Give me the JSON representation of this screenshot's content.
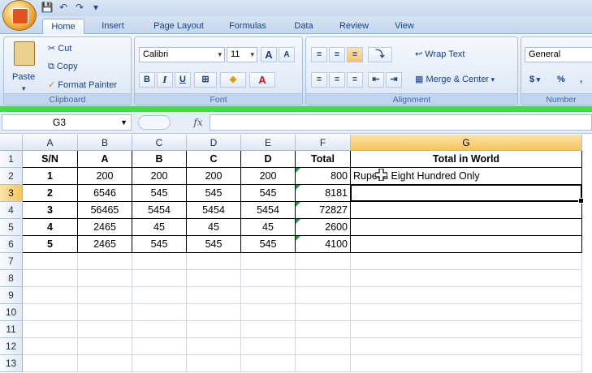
{
  "quick_access": {
    "save_icon": "save-icon",
    "undo_icon": "undo-icon",
    "redo_icon": "redo-icon"
  },
  "tabs": [
    "Home",
    "Insert",
    "Page Layout",
    "Formulas",
    "Data",
    "Review",
    "View"
  ],
  "clipboard": {
    "paste": "Paste",
    "cut": "Cut",
    "copy": "Copy",
    "format_painter": "Format Painter",
    "label": "Clipboard"
  },
  "font": {
    "name": "Calibri",
    "size": "11",
    "bold": "B",
    "italic": "I",
    "underline": "U",
    "label": "Font",
    "grow": "A",
    "shrink": "A"
  },
  "alignment": {
    "wrap_text": "Wrap Text",
    "merge_center": "Merge & Center",
    "label": "Alignment"
  },
  "number": {
    "format": "General",
    "currency": "$",
    "percent": "%",
    "comma": ",",
    "label": "Number"
  },
  "formula_bar": {
    "name_box": "G3",
    "fx": "fx",
    "value": ""
  },
  "columns": [
    "A",
    "B",
    "C",
    "D",
    "E",
    "F",
    "G"
  ],
  "rows": [
    "1",
    "2",
    "3",
    "4",
    "5",
    "6",
    "7",
    "8",
    "9",
    "10",
    "11",
    "12",
    "13"
  ],
  "table": {
    "header": [
      "S/N",
      "A",
      "B",
      "C",
      "D",
      "Total",
      "Total in World"
    ],
    "data": [
      [
        "1",
        "200",
        "200",
        "200",
        "200",
        "800",
        "Rupees Eight Hundred  Only"
      ],
      [
        "2",
        "6546",
        "545",
        "545",
        "545",
        "8181",
        ""
      ],
      [
        "3",
        "56465",
        "5454",
        "5454",
        "5454",
        "72827",
        ""
      ],
      [
        "4",
        "2465",
        "45",
        "45",
        "45",
        "2600",
        ""
      ],
      [
        "5",
        "2465",
        "545",
        "545",
        "545",
        "4100",
        ""
      ]
    ]
  },
  "selected_cell": "G3"
}
